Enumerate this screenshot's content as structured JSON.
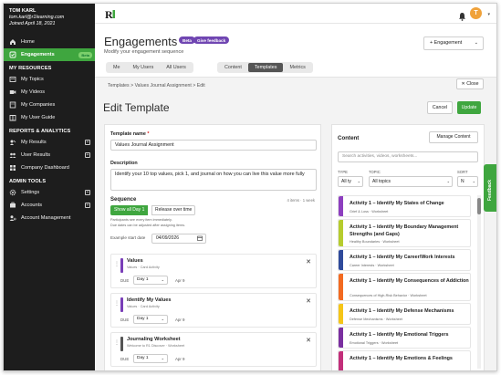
{
  "user": {
    "name": "TOM KARL",
    "email": "tom.karl@r1learning.com",
    "joined": "Joined April 18, 2021"
  },
  "sidebar": {
    "top_items": [
      {
        "label": "Home",
        "icon": "home-icon"
      },
      {
        "label": "Engagements",
        "icon": "engagement-icon",
        "badge": "Beta",
        "active": true
      }
    ],
    "sections": [
      {
        "title": "MY RESOURCES",
        "items": [
          {
            "label": "My Topics",
            "icon": "topic-icon"
          },
          {
            "label": "My Videos",
            "icon": "video-icon"
          },
          {
            "label": "My Companies",
            "icon": "company-icon"
          },
          {
            "label": "My User Guide",
            "icon": "guide-icon"
          }
        ]
      },
      {
        "title": "REPORTS & ANALYTICS",
        "items": [
          {
            "label": "My Results",
            "icon": "results-icon",
            "expandable": true
          },
          {
            "label": "User Results",
            "icon": "user-results-icon",
            "expandable": true
          },
          {
            "label": "Company Dashboard",
            "icon": "dashboard-icon"
          }
        ]
      },
      {
        "title": "ADMIN TOOLS",
        "items": [
          {
            "label": "Settings",
            "icon": "gear-icon",
            "expandable": true
          },
          {
            "label": "Accounts",
            "icon": "accounts-icon",
            "expandable": true
          },
          {
            "label": "Account Management",
            "icon": "account-mgmt-icon"
          }
        ]
      }
    ]
  },
  "topbar": {
    "avatar_initial": "T",
    "accent": "#3fa63f",
    "avatar_color": "#f0a23a"
  },
  "header": {
    "title": "Engagements",
    "beta": "Beta",
    "feedback": "Give feedback",
    "subtitle": "Modify your engagement sequence",
    "engagement_button": "+ Engagement",
    "scope_tabs": [
      "Me",
      "My Users",
      "All Users"
    ],
    "view_tabs": [
      "Content",
      "Templates",
      "Metrics"
    ],
    "selected_view": "Templates"
  },
  "breadcrumb": {
    "items": [
      "Templates",
      "Values Journal Assignment",
      "Edit"
    ],
    "close": "✕ Close"
  },
  "edit": {
    "title": "Edit Template",
    "cancel": "Cancel",
    "update": "Update"
  },
  "form": {
    "name_label": "Template name",
    "name_required": "*",
    "name_value": "Values Journal Assignment",
    "desc_label": "Description",
    "desc_value": "Identify your 10 top values, pick 1, and journal on how you can live this value more fully",
    "sequence_label": "Sequence",
    "sequence_count": "4 items · 1 week",
    "show_all": "Show all Day 1",
    "release": "Release over time",
    "note1": "Participants see every item immediately.",
    "note2": "Due dates can be adjusted after assigning items.",
    "start_label": "Example start date",
    "start_value": "04/09/2026",
    "due_label": "DUE"
  },
  "sequence_items": [
    {
      "title": "Values",
      "type": "Values · Card Activity",
      "day": "Day 1",
      "date": "Apr 9",
      "color": "#7a3fb8"
    },
    {
      "title": "Identify My Values",
      "type": "Values · Card Activity",
      "day": "Day 1",
      "date": "Apr 9",
      "color": "#7a3fb8"
    },
    {
      "title": "Journaling Worksheet",
      "type": "Welcome to R1 Discover · Worksheet",
      "day": "Day 1",
      "date": "Apr 9",
      "color": "#555555"
    }
  ],
  "content_panel": {
    "title": "Content",
    "manage": "Manage Content",
    "search_placeholder": "Search activities, videos, worksheets...",
    "type_label": "TYPE",
    "type_value": "All ty",
    "topic_label": "TOPIC",
    "topic_value": "All topics",
    "sort_label": "SORT",
    "sort_value": "N",
    "activities": [
      {
        "title": "Activity 1 – Identify My States of Change",
        "sub": "Grief & Loss · Worksheet",
        "color": "#8d3fbf"
      },
      {
        "title": "Activity 1 – Identify My Boundary Management Strengths (and Gaps)",
        "sub": "Healthy Boundaries · Worksheet",
        "color": "#b6cc2e"
      },
      {
        "title": "Activity 1 – Identify My Career/Work Interests",
        "sub": "Career Interests · Worksheet",
        "color": "#2f4a9b"
      },
      {
        "title": "Activity 1 – Identify My Consequences of Addiction",
        "sub": "Consequences of High-Risk Behavior · Worksheet",
        "color": "#f26a21"
      },
      {
        "title": "Activity 1 – Identify My Defense Mechanisms",
        "sub": "Defense Mechanisms · Worksheet",
        "color": "#f5c518"
      },
      {
        "title": "Activity 1 – Identify My Emotional Triggers",
        "sub": "Emotional Triggers · Worksheet",
        "color": "#7a2fa0"
      },
      {
        "title": "Activity 1 – Identify My Emotions & Feelings",
        "sub": "",
        "color": "#c22f7a"
      }
    ]
  },
  "feedback_tab": "Feedback"
}
